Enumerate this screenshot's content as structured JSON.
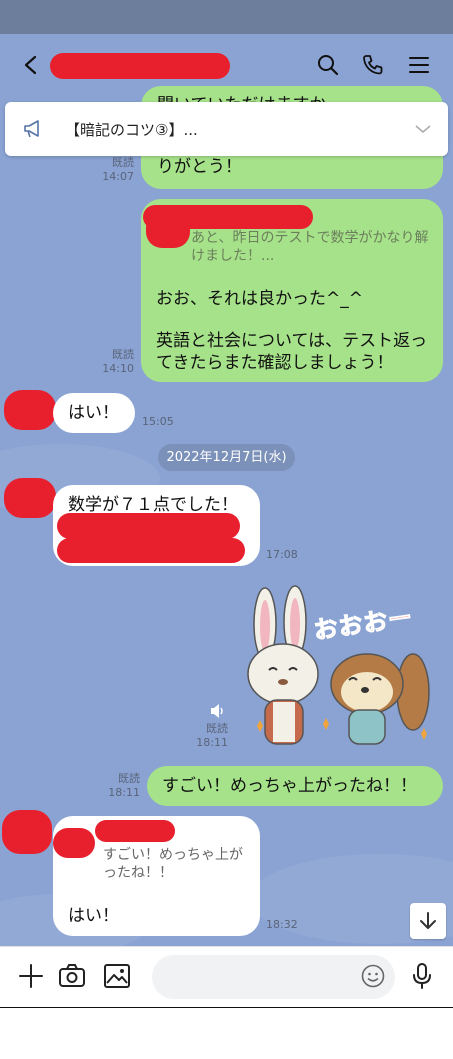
{
  "announcement": {
    "text": "【暗記のコツ③】..."
  },
  "messages": {
    "m1": {
      "text_top": "聞いていただけますか",
      "text": "りがとう！",
      "read": "既読",
      "time": "14:07"
    },
    "m2": {
      "quote": "あと、昨日のテストで数学がかなり解けました！...",
      "line1": "おお、それは良かった^_^",
      "line2": "英語と社会については、テスト返ってきたらまた確認しましょう！",
      "read": "既読",
      "time": "14:10"
    },
    "m3": {
      "text": "はい！",
      "time": "15:05"
    },
    "date": "2022年12月7日(水)",
    "m4": {
      "text": "数学が７１点でした！",
      "time": "17:08"
    },
    "m5": {
      "sticker_text": "おおおー",
      "read": "既読",
      "time": "18:11"
    },
    "m6": {
      "text": "すごい！めっちゃ上がったね！！",
      "read": "既読",
      "time": "18:11"
    },
    "m7": {
      "quote": "すごい！めっちゃ上がったね！！",
      "text": "はい！",
      "time": "18:32"
    }
  },
  "colors": {
    "chat_bg": "#8aa3d3",
    "outgoing": "#a6e28a",
    "incoming": "#ffffff",
    "redaction": "#e8202e"
  }
}
